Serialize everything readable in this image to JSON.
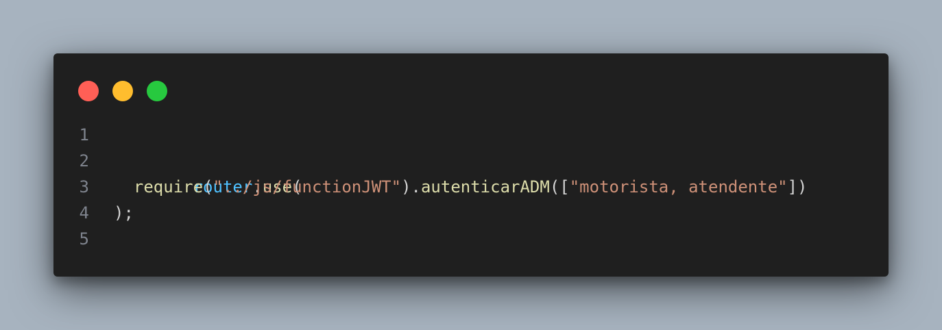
{
  "window": {
    "traffic_lights": [
      {
        "name": "close",
        "color": "#ff5f56"
      },
      {
        "name": "minimize",
        "color": "#ffbd2e"
      },
      {
        "name": "maximize",
        "color": "#27c93f"
      }
    ]
  },
  "code": {
    "lines": [
      {
        "number": "1",
        "tokens": []
      },
      {
        "number": "2",
        "tokens": [
          {
            "text": "router",
            "kind": "var"
          },
          {
            "text": ".",
            "kind": "punc"
          },
          {
            "text": "use",
            "kind": "fn"
          },
          {
            "text": "(",
            "kind": "punc"
          }
        ]
      },
      {
        "number": "3",
        "tokens": [
          {
            "text": "  ",
            "kind": "punc"
          },
          {
            "text": "require",
            "kind": "fn"
          },
          {
            "text": "(",
            "kind": "punc"
          },
          {
            "text": "\"../js/functionJWT\"",
            "kind": "str"
          },
          {
            "text": ").",
            "kind": "punc"
          },
          {
            "text": "autenticarADM",
            "kind": "fn"
          },
          {
            "text": "([",
            "kind": "punc"
          },
          {
            "text": "\"motorista, atendente\"",
            "kind": "str"
          },
          {
            "text": "])",
            "kind": "punc"
          }
        ]
      },
      {
        "number": "4",
        "tokens": [
          {
            "text": ");",
            "kind": "punc"
          }
        ]
      },
      {
        "number": "5",
        "tokens": []
      }
    ],
    "colors": {
      "var": "#4fc1ff",
      "fn": "#dcdcaa",
      "str": "#ce9178",
      "punc": "#d4d4d4",
      "line_number": "#7f848e",
      "background": "#1f1f1f"
    }
  }
}
